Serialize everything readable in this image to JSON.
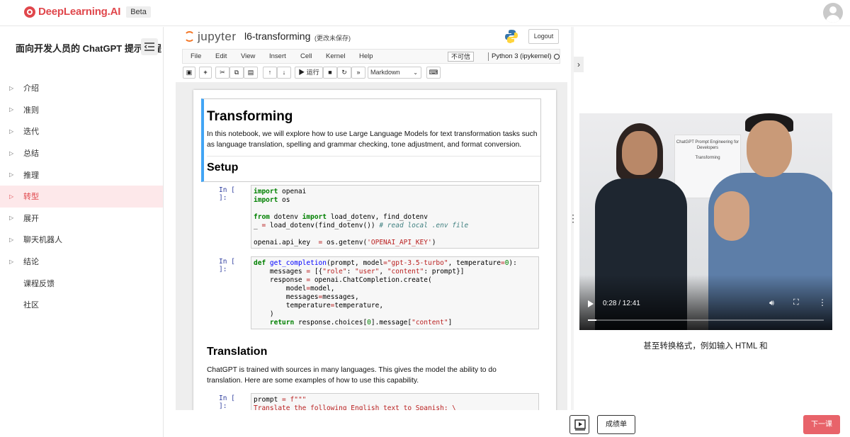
{
  "topbar": {
    "brand": "DeepLearning.AI",
    "badge": "Beta"
  },
  "sidebar": {
    "title": "面向开发人员的 ChatGPT 提示工程",
    "items": [
      {
        "label": "介绍",
        "arrow": true,
        "active": false
      },
      {
        "label": "准则",
        "arrow": true,
        "active": false
      },
      {
        "label": "迭代",
        "arrow": true,
        "active": false
      },
      {
        "label": "总结",
        "arrow": true,
        "active": false
      },
      {
        "label": "推理",
        "arrow": true,
        "active": false
      },
      {
        "label": "转型",
        "arrow": true,
        "active": true
      },
      {
        "label": "展开",
        "arrow": true,
        "active": false
      },
      {
        "label": "聊天机器人",
        "arrow": true,
        "active": false
      },
      {
        "label": "结论",
        "arrow": true,
        "active": false
      },
      {
        "label": "课程反馈",
        "arrow": false,
        "active": false
      },
      {
        "label": "社区",
        "arrow": false,
        "active": false
      }
    ],
    "active_color": "#e0474c"
  },
  "notebook": {
    "logo": "jupyter",
    "name": "l6-transforming",
    "unsaved": "(更改未保存)",
    "logout": "Logout",
    "menu": [
      "File",
      "Edit",
      "View",
      "Insert",
      "Cell",
      "Kernel",
      "Help"
    ],
    "trust": "不可信",
    "kernel": "Python 3 (ipykernel)",
    "toolbar": {
      "run": "▶ 运行",
      "cell_type": "Markdown"
    },
    "markdown": {
      "title": "Transforming",
      "intro": "In this notebook, we will explore how to use Large Language Models for text transformation tasks such as language translation, spelling and grammar checking, tone adjustment, and format conversion.",
      "setup": "Setup"
    },
    "prompt": "In [ ]:",
    "translation": {
      "title": "Translation",
      "text": "ChatGPT is trained with sources in many languages. This gives the model the ability to do translation. Here are some examples of how to use this capability."
    }
  },
  "video": {
    "screen_text": "ChatGPT Prompt Engineering for Developers",
    "screen_sub": "Transforming",
    "time": "0:28 / 12:41",
    "progress": 0.037,
    "caption": "甚至转换格式，例如输入 HTML 和"
  },
  "bottom": {
    "grades": "成绩单",
    "next": "下一课"
  }
}
